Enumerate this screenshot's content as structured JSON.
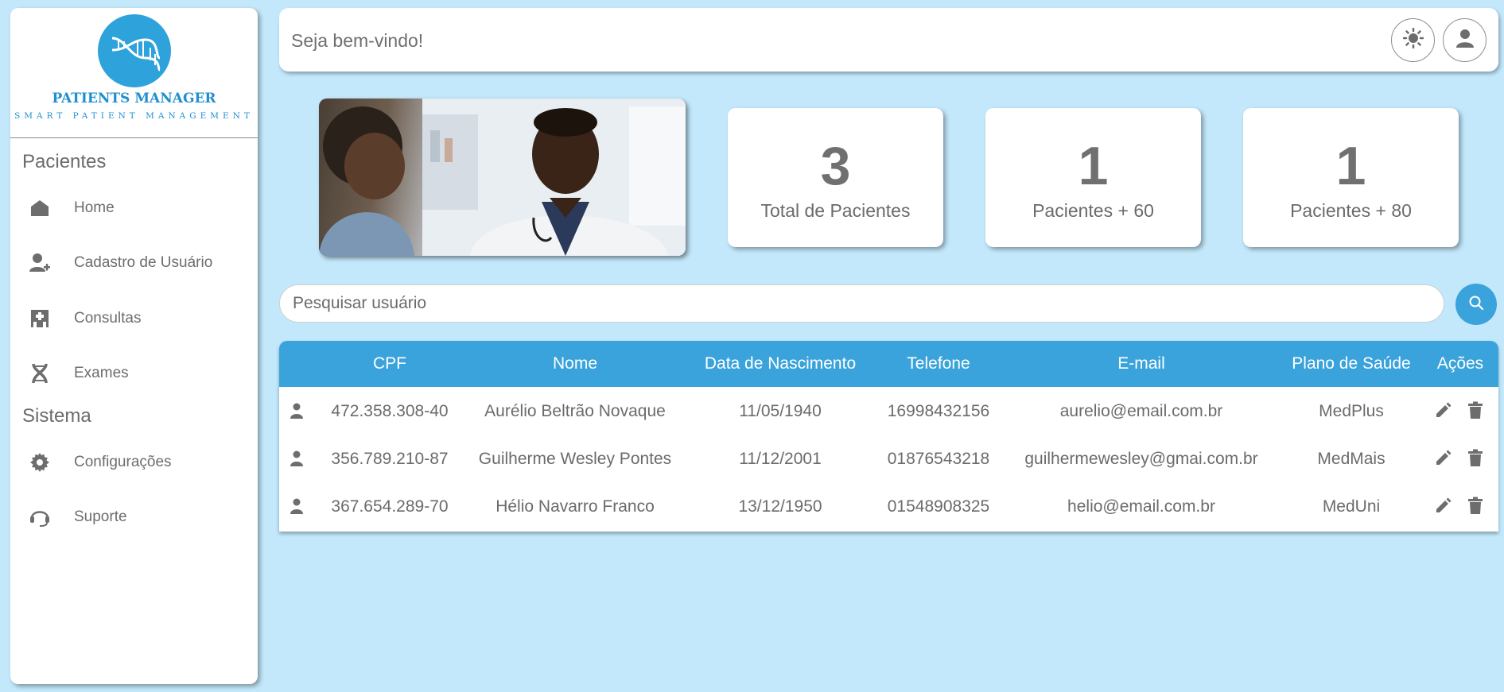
{
  "brand": {
    "title": "PATIENTS MANAGER",
    "subtitle": "SMART PATIENT MANAGEMENT",
    "accent": "#2ea2db"
  },
  "sidebar": {
    "sections": [
      {
        "title": "Pacientes",
        "items": [
          {
            "label": "Home",
            "icon": "home-icon"
          },
          {
            "label": "Cadastro de Usuário",
            "icon": "add-user-icon"
          },
          {
            "label": "Consultas",
            "icon": "hospital-icon"
          },
          {
            "label": "Exames",
            "icon": "dna-icon"
          }
        ]
      },
      {
        "title": "Sistema",
        "items": [
          {
            "label": "Configurações",
            "icon": "gear-icon"
          },
          {
            "label": "Suporte",
            "icon": "headset-icon"
          }
        ]
      }
    ]
  },
  "header": {
    "welcome": "Seja bem-vindo!",
    "theme_icon": "sun-icon",
    "profile_icon": "user-icon"
  },
  "stats": [
    {
      "value": "3",
      "label": "Total de Pacientes"
    },
    {
      "value": "1",
      "label": "Pacientes + 60"
    },
    {
      "value": "1",
      "label": "Pacientes + 80"
    }
  ],
  "search": {
    "placeholder": "Pesquisar usuário",
    "value": "",
    "icon": "search-icon"
  },
  "table": {
    "header_color": "#3aa3dc",
    "columns": [
      "CPF",
      "Nome",
      "Data de Nascimento",
      "Telefone",
      "E-mail",
      "Plano de Saúde",
      "Ações"
    ],
    "rows": [
      {
        "cpf": "472.358.308-40",
        "nome": "Aurélio Beltrão Novaque",
        "nascimento": "11/05/1940",
        "telefone": "16998432156",
        "email": "aurelio@email.com.br",
        "plano": "MedPlus"
      },
      {
        "cpf": "356.789.210-87",
        "nome": "Guilherme Wesley Pontes",
        "nascimento": "11/12/2001",
        "telefone": "01876543218",
        "email": "guilhermewesley@gmai.com.br",
        "plano": "MedMais"
      },
      {
        "cpf": "367.654.289-70",
        "nome": "Hélio Navarro Franco",
        "nascimento": "13/12/1950",
        "telefone": "01548908325",
        "email": "helio@email.com.br",
        "plano": "MedUni"
      }
    ]
  }
}
